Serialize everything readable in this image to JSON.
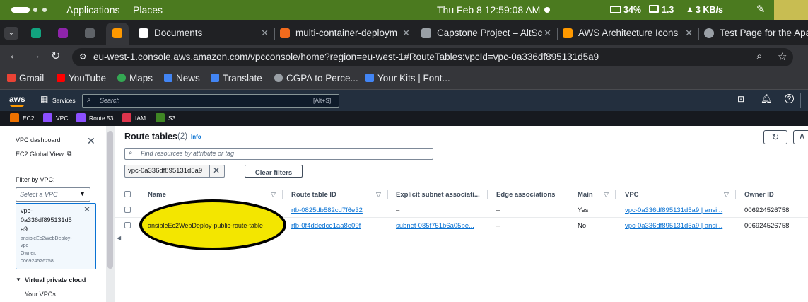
{
  "os_bar": {
    "applications": "Applications",
    "places": "Places",
    "clock": "Thu Feb 8  12:59:08 AM",
    "battery": "34%",
    "load": "1.3",
    "net": "3 KB/s"
  },
  "tabs": [
    {
      "label": "",
      "icon_color": "#12a37f"
    },
    {
      "label": "",
      "icon_color": "#8e24aa"
    },
    {
      "label": "",
      "icon_color": "#5f6368"
    },
    {
      "label": "",
      "icon_color": "#ff9900"
    },
    {
      "label": "Documents",
      "icon_color": "#ffffff"
    },
    {
      "label": "multi-container-deploym",
      "icon_color": "#f26b1d"
    },
    {
      "label": "Capstone Project – AltSc",
      "icon_color": "#9aa0a6"
    },
    {
      "label": "AWS Architecture Icons",
      "icon_color": "#ff9900"
    },
    {
      "label": "Test Page for the Apac",
      "icon_color": "#9aa0a6"
    }
  ],
  "address": {
    "url": "eu-west-1.console.aws.amazon.com/vpcconsole/home?region=eu-west-1#RouteTables:vpcId=vpc-0a336df895131d5a9"
  },
  "bookmarks": [
    {
      "label": "Gmail",
      "color": "#ea4335"
    },
    {
      "label": "YouTube",
      "color": "#ff0000"
    },
    {
      "label": "Maps",
      "color": "#34a853"
    },
    {
      "label": "News",
      "color": "#4285f4"
    },
    {
      "label": "Translate",
      "color": "#4285f4"
    },
    {
      "label": "CGPA to Perce...",
      "color": "#9aa0a6"
    },
    {
      "label": "Your Kits | Font...",
      "color": "#4285f4"
    }
  ],
  "aws_nav": {
    "logo": "aws",
    "services": "Services",
    "search_placeholder": "Search",
    "search_shortcut": "[Alt+S]"
  },
  "favorites": [
    {
      "label": "EC2",
      "color": "#ed7100"
    },
    {
      "label": "VPC",
      "color": "#8c4fff"
    },
    {
      "label": "Route 53",
      "color": "#8c4fff"
    },
    {
      "label": "IAM",
      "color": "#dd344c"
    },
    {
      "label": "S3",
      "color": "#3f8624"
    }
  ],
  "sidebar": {
    "vpc_dashboard": "VPC dashboard",
    "ec2_global_view": "EC2 Global View",
    "filter_label": "Filter by VPC:",
    "select_placeholder": "Select a VPC",
    "selected_vpc": "vpc-0a336df895131d5a9",
    "selected_vpc_line1": "vpc-",
    "selected_vpc_line2": "0a336df895131d5",
    "selected_vpc_line3": "a9",
    "selected_vpc_name1": "ansibleEc2WebDeploy-",
    "selected_vpc_name2": "vpc",
    "selected_vpc_owner_label": "Owner:",
    "selected_vpc_owner": "006924526758",
    "section_title": "Virtual private cloud",
    "your_vpcs": "Your VPCs"
  },
  "main": {
    "title": "Route tables",
    "count": "(2)",
    "info": "Info",
    "search_placeholder": "Find resources by attribute or tag",
    "filter_token": "vpc-0a336df895131d5a9",
    "clear_filters": "Clear filters",
    "refresh_icon": "refresh-icon",
    "actions_fragment": "A",
    "columns": [
      "Name",
      "Route table ID",
      "Explicit subnet associati...",
      "Edge associations",
      "Main",
      "VPC",
      "Owner ID"
    ],
    "rows": [
      {
        "name": "",
        "route_table_id": "rtb-0825db582cd7f6e32",
        "explicit_subnet": "–",
        "edge": "–",
        "main": "Yes",
        "vpc": "vpc-0a336df895131d5a9 | ansi...",
        "owner": "006924526758"
      },
      {
        "name": "ansibleEc2WebDeploy-public-route-table",
        "route_table_id": "rtb-0f4ddedce1aa8e09f",
        "explicit_subnet": "subnet-085f751b6a05be...",
        "edge": "–",
        "main": "No",
        "vpc": "vpc-0a336df895131d5a9 | ansi...",
        "owner": "006924526758"
      }
    ],
    "highlight_color": "#f3e600"
  }
}
